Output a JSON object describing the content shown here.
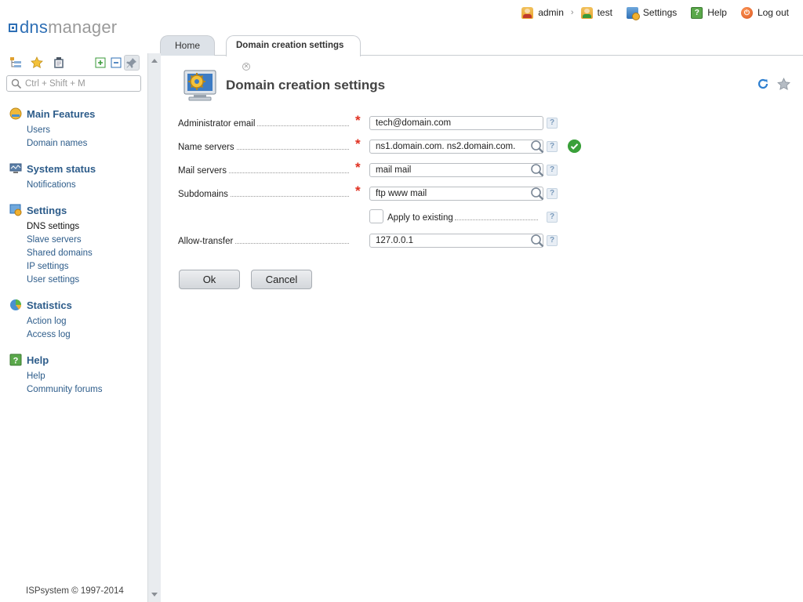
{
  "logo": {
    "part1": "dns",
    "part2": "manager"
  },
  "topnav": {
    "user": "admin",
    "separator": "›",
    "subuser": "test",
    "settings": "Settings",
    "help": "Help",
    "logout": "Log out"
  },
  "tabs": [
    {
      "label": "Home"
    },
    {
      "label": "Domain creation settings"
    }
  ],
  "sidebar": {
    "search_placeholder": "Ctrl + Shift + M",
    "groups": [
      {
        "title": "Main Features",
        "icon": "main-features-icon",
        "items": [
          "Users",
          "Domain names"
        ]
      },
      {
        "title": "System status",
        "icon": "system-status-icon",
        "items": [
          "Notifications"
        ]
      },
      {
        "title": "Settings",
        "icon": "settings-group-icon",
        "items": [
          "DNS settings",
          "Slave servers",
          "Shared domains",
          "IP settings",
          "User settings"
        ]
      },
      {
        "title": "Statistics",
        "icon": "statistics-icon",
        "items": [
          "Action log",
          "Access log"
        ]
      },
      {
        "title": "Help",
        "icon": "help-group-icon",
        "items": [
          "Help",
          "Community forums"
        ]
      }
    ],
    "current_item": "DNS settings",
    "footer": "ISPsystem © 1997-2014"
  },
  "page": {
    "title": "Domain creation settings"
  },
  "form": {
    "admin_email": {
      "label": "Administrator email",
      "value": "tech@domain.com",
      "help": "?"
    },
    "name_servers": {
      "label": "Name servers",
      "value": "ns1.domain.com. ns2.domain.com.",
      "help": "?"
    },
    "mail_servers": {
      "label": "Mail servers",
      "value": "mail mail",
      "help": "?"
    },
    "subdomains": {
      "label": "Subdomains",
      "value": "ftp www mail",
      "help": "?"
    },
    "apply_existing": {
      "label": "Apply to existing",
      "checked": false,
      "help": "?"
    },
    "allow_transfer": {
      "label": "Allow-transfer",
      "value": "127.0.0.1",
      "help": "?"
    },
    "required_mark": "*"
  },
  "buttons": {
    "ok": "Ok",
    "cancel": "Cancel"
  },
  "colors": {
    "accent": "#2e6fb5",
    "link": "#2d5c8a",
    "required": "#e03020",
    "valid": "#3aa03a"
  }
}
